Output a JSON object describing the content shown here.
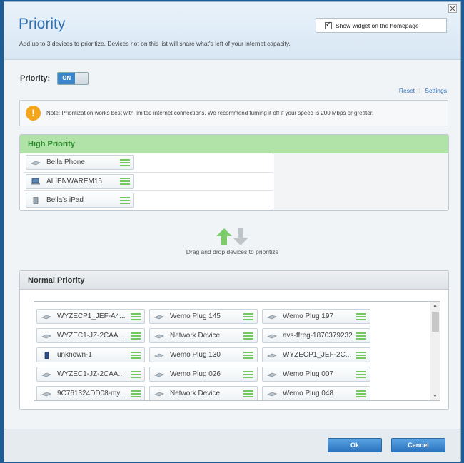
{
  "dialog": {
    "title": "Priority",
    "subtitle": "Add up to 3 devices to prioritize. Devices not on this list will share what's left of your internet capacity.",
    "close_glyph": "✕",
    "widget_label": "Show widget on the homepage",
    "widget_checked": true
  },
  "priority": {
    "label": "Priority:",
    "toggle_on": "ON"
  },
  "links": {
    "reset": "Reset",
    "separator": "|",
    "settings": "Settings"
  },
  "note": {
    "icon": "!",
    "text": "Note: Prioritization works best with limited internet connections. We recommend turning it off if your speed is 200 Mbps or greater."
  },
  "high_priority": {
    "title": "High Priority",
    "devices": [
      {
        "name": "Bella Phone",
        "icon": "device-icon"
      },
      {
        "name": "ALIENWAREM15",
        "icon": "computer-icon"
      },
      {
        "name": "Bella's iPad",
        "icon": "tablet-icon"
      }
    ]
  },
  "drag_drop": {
    "text": "Drag and drop devices to prioritize"
  },
  "normal_priority": {
    "title": "Normal Priority",
    "devices": [
      [
        "WYZECP1_JEF-A4...",
        "Wemo Plug 145",
        "Wemo Plug 197"
      ],
      [
        "WYZEC1-JZ-2CAA...",
        "Network Device",
        "avs-ffreg-1870379232"
      ],
      [
        "unknown-1",
        "Wemo Plug 130",
        "WYZECP1_JEF-2C..."
      ],
      [
        "WYZEC1-JZ-2CAA...",
        "Wemo Plug 026",
        "Wemo Plug 007"
      ],
      [
        "9C761324DD08-my...",
        "Network Device",
        "Wemo Plug 048"
      ]
    ]
  },
  "buttons": {
    "ok": "Ok",
    "cancel": "Cancel"
  },
  "colors": {
    "title_blue": "#2f6fae",
    "high_header": "#b1e2a7",
    "high_header_text": "#2c8c2e",
    "grip_green": "#72c95f",
    "warn_orange": "#f3a51c",
    "button_blue": "#2b74bf"
  }
}
